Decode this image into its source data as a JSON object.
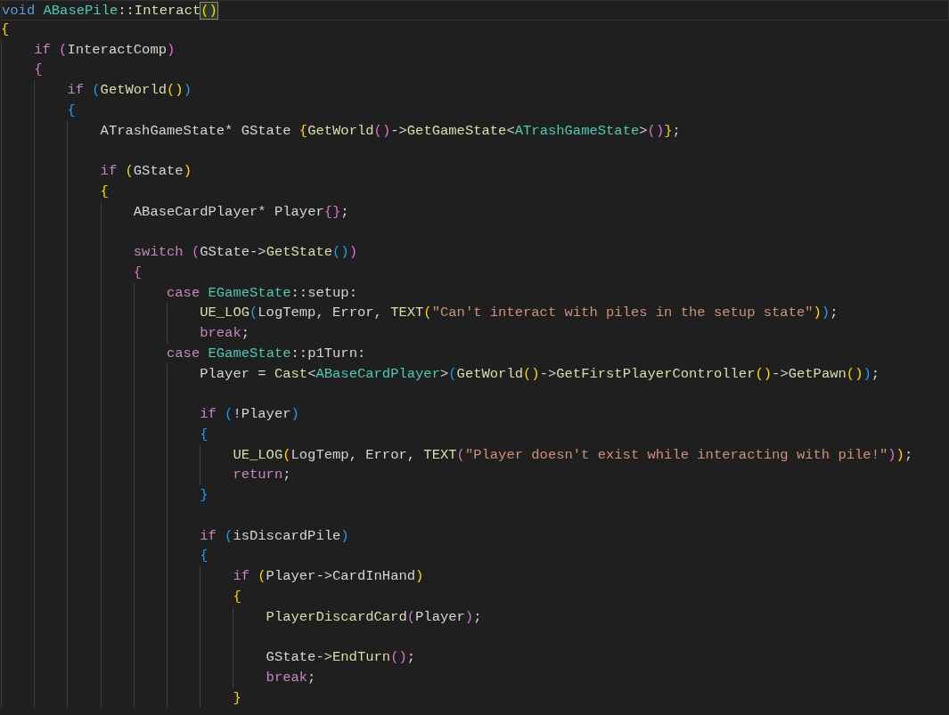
{
  "editor": {
    "lines": [
      {
        "current": true,
        "tokens": [
          {
            "text": "void",
            "kind": "kw"
          },
          {
            "text": " ABasePile",
            "kind": "type"
          },
          {
            "text": "::",
            "kind": "txt"
          },
          {
            "text": "Interact",
            "kind": "fn"
          },
          {
            "text": "()",
            "kind": "ym"
          }
        ]
      },
      {
        "current": false,
        "tokens": [
          {
            "text": "{",
            "kind": "y"
          }
        ],
        "children": [
          {
            "current": false,
            "tokens": [
              {
                "text": "if",
                "kind": "ctl"
              },
              {
                "text": " (",
                "kind": "p"
              },
              {
                "text": "InteractComp",
                "kind": "txt"
              },
              {
                "text": ")",
                "kind": "p"
              }
            ]
          },
          {
            "current": false,
            "tokens": [
              {
                "text": "{",
                "kind": "p"
              }
            ],
            "children": [
              {
                "current": false,
                "tokens": [
                  {
                    "text": "if",
                    "kind": "ctl"
                  },
                  {
                    "text": " (",
                    "kind": "b"
                  },
                  {
                    "text": "GetWorld",
                    "kind": "fn"
                  },
                  {
                    "text": "()",
                    "kind": "y"
                  },
                  {
                    "text": ")",
                    "kind": "b"
                  }
                ]
              },
              {
                "current": false,
                "tokens": [
                  {
                    "text": "{",
                    "kind": "b"
                  }
                ],
                "children": [
                  {
                    "current": false,
                    "tokens": [
                      {
                        "text": "ATrashGameState* GState ",
                        "kind": "txt"
                      },
                      {
                        "text": "{",
                        "kind": "y"
                      },
                      {
                        "text": "GetWorld",
                        "kind": "fn"
                      },
                      {
                        "text": "()",
                        "kind": "p"
                      },
                      {
                        "text": "->",
                        "kind": "txt"
                      },
                      {
                        "text": "GetGameState",
                        "kind": "fn"
                      },
                      {
                        "text": "<",
                        "kind": "txt"
                      },
                      {
                        "text": "ATrashGameState",
                        "kind": "type"
                      },
                      {
                        "text": ">",
                        "kind": "txt"
                      },
                      {
                        "text": "()",
                        "kind": "p"
                      },
                      {
                        "text": "}",
                        "kind": "y"
                      },
                      {
                        "text": ";",
                        "kind": "txt"
                      }
                    ]
                  },
                  {
                    "current": false
                  },
                  {
                    "current": false,
                    "tokens": [
                      {
                        "text": "if",
                        "kind": "ctl"
                      },
                      {
                        "text": " (",
                        "kind": "y"
                      },
                      {
                        "text": "GState",
                        "kind": "txt"
                      },
                      {
                        "text": ")",
                        "kind": "y"
                      }
                    ]
                  },
                  {
                    "current": false,
                    "tokens": [
                      {
                        "text": "{",
                        "kind": "y"
                      }
                    ],
                    "children": [
                      {
                        "current": false,
                        "tokens": [
                          {
                            "text": "ABaseCardPlayer* Player",
                            "kind": "txt"
                          },
                          {
                            "text": "{}",
                            "kind": "p"
                          },
                          {
                            "text": ";",
                            "kind": "txt"
                          }
                        ]
                      },
                      {
                        "current": false
                      },
                      {
                        "current": false,
                        "tokens": [
                          {
                            "text": "switch",
                            "kind": "ctl"
                          },
                          {
                            "text": " (",
                            "kind": "p"
                          },
                          {
                            "text": "GState->",
                            "kind": "txt"
                          },
                          {
                            "text": "GetState",
                            "kind": "fn"
                          },
                          {
                            "text": "()",
                            "kind": "b"
                          },
                          {
                            "text": ")",
                            "kind": "p"
                          }
                        ]
                      },
                      {
                        "current": false,
                        "tokens": [
                          {
                            "text": "{",
                            "kind": "p"
                          }
                        ],
                        "children": [
                          {
                            "current": false,
                            "tokens": [
                              {
                                "text": "case",
                                "kind": "ctl"
                              },
                              {
                                "text": " EGameState",
                                "kind": "type"
                              },
                              {
                                "text": "::setup:",
                                "kind": "txt"
                              }
                            ],
                            "children": [
                              {
                                "current": false,
                                "tokens": [
                                  {
                                    "text": "UE_LOG",
                                    "kind": "fn"
                                  },
                                  {
                                    "text": "(",
                                    "kind": "b"
                                  },
                                  {
                                    "text": "LogTemp, Error, ",
                                    "kind": "txt"
                                  },
                                  {
                                    "text": "TEXT",
                                    "kind": "fn"
                                  },
                                  {
                                    "text": "(",
                                    "kind": "y"
                                  },
                                  {
                                    "text": "\"Can't interact with piles in the setup state\"",
                                    "kind": "str"
                                  },
                                  {
                                    "text": ")",
                                    "kind": "y"
                                  },
                                  {
                                    "text": ")",
                                    "kind": "b"
                                  },
                                  {
                                    "text": ";",
                                    "kind": "txt"
                                  }
                                ]
                              },
                              {
                                "current": false,
                                "tokens": [
                                  {
                                    "text": "break",
                                    "kind": "ctl"
                                  },
                                  {
                                    "text": ";",
                                    "kind": "txt"
                                  }
                                ]
                              }
                            ]
                          },
                          {
                            "current": false,
                            "tokens": [
                              {
                                "text": "case",
                                "kind": "ctl"
                              },
                              {
                                "text": " EGameState",
                                "kind": "type"
                              },
                              {
                                "text": "::p1Turn:",
                                "kind": "txt"
                              }
                            ],
                            "children": [
                              {
                                "current": false,
                                "tokens": [
                                  {
                                    "text": "Player = ",
                                    "kind": "txt"
                                  },
                                  {
                                    "text": "Cast",
                                    "kind": "fn"
                                  },
                                  {
                                    "text": "<",
                                    "kind": "txt"
                                  },
                                  {
                                    "text": "ABaseCardPlayer",
                                    "kind": "type"
                                  },
                                  {
                                    "text": ">",
                                    "kind": "txt"
                                  },
                                  {
                                    "text": "(",
                                    "kind": "b"
                                  },
                                  {
                                    "text": "GetWorld",
                                    "kind": "fn"
                                  },
                                  {
                                    "text": "()",
                                    "kind": "y"
                                  },
                                  {
                                    "text": "->",
                                    "kind": "txt"
                                  },
                                  {
                                    "text": "GetFirstPlayerController",
                                    "kind": "fn"
                                  },
                                  {
                                    "text": "()",
                                    "kind": "y"
                                  },
                                  {
                                    "text": "->",
                                    "kind": "txt"
                                  },
                                  {
                                    "text": "GetPawn",
                                    "kind": "fn"
                                  },
                                  {
                                    "text": "()",
                                    "kind": "y"
                                  },
                                  {
                                    "text": ")",
                                    "kind": "b"
                                  },
                                  {
                                    "text": ";",
                                    "kind": "txt"
                                  }
                                ]
                              },
                              {
                                "current": false
                              },
                              {
                                "current": false,
                                "tokens": [
                                  {
                                    "text": "if",
                                    "kind": "ctl"
                                  },
                                  {
                                    "text": " (",
                                    "kind": "b"
                                  },
                                  {
                                    "text": "!Player",
                                    "kind": "txt"
                                  },
                                  {
                                    "text": ")",
                                    "kind": "b"
                                  }
                                ]
                              },
                              {
                                "current": false,
                                "tokens": [
                                  {
                                    "text": "{",
                                    "kind": "b"
                                  }
                                ],
                                "children": [
                                  {
                                    "current": false,
                                    "tokens": [
                                      {
                                        "text": "UE_LOG",
                                        "kind": "fn"
                                      },
                                      {
                                        "text": "(",
                                        "kind": "y"
                                      },
                                      {
                                        "text": "LogTemp, Error, ",
                                        "kind": "txt"
                                      },
                                      {
                                        "text": "TEXT",
                                        "kind": "fn"
                                      },
                                      {
                                        "text": "(",
                                        "kind": "p"
                                      },
                                      {
                                        "text": "\"Player doesn't exist while interacting with pile!\"",
                                        "kind": "str"
                                      },
                                      {
                                        "text": ")",
                                        "kind": "p"
                                      },
                                      {
                                        "text": ")",
                                        "kind": "y"
                                      },
                                      {
                                        "text": ";",
                                        "kind": "txt"
                                      }
                                    ]
                                  },
                                  {
                                    "current": false,
                                    "tokens": [
                                      {
                                        "text": "return",
                                        "kind": "ctl"
                                      },
                                      {
                                        "text": ";",
                                        "kind": "txt"
                                      }
                                    ]
                                  }
                                ]
                              },
                              {
                                "current": false,
                                "tokens": [
                                  {
                                    "text": "}",
                                    "kind": "b"
                                  }
                                ]
                              },
                              {
                                "current": false
                              },
                              {
                                "current": false,
                                "tokens": [
                                  {
                                    "text": "if",
                                    "kind": "ctl"
                                  },
                                  {
                                    "text": " (",
                                    "kind": "b"
                                  },
                                  {
                                    "text": "isDiscardPile",
                                    "kind": "txt"
                                  },
                                  {
                                    "text": ")",
                                    "kind": "b"
                                  }
                                ]
                              },
                              {
                                "current": false,
                                "tokens": [
                                  {
                                    "text": "{",
                                    "kind": "b"
                                  }
                                ],
                                "children": [
                                  {
                                    "current": false,
                                    "tokens": [
                                      {
                                        "text": "if",
                                        "kind": "ctl"
                                      },
                                      {
                                        "text": " (",
                                        "kind": "y"
                                      },
                                      {
                                        "text": "Player->CardInHand",
                                        "kind": "txt"
                                      },
                                      {
                                        "text": ")",
                                        "kind": "y"
                                      }
                                    ]
                                  },
                                  {
                                    "current": false,
                                    "tokens": [
                                      {
                                        "text": "{",
                                        "kind": "y"
                                      }
                                    ],
                                    "children": [
                                      {
                                        "current": false,
                                        "tokens": [
                                          {
                                            "text": "PlayerDiscardCard",
                                            "kind": "fn"
                                          },
                                          {
                                            "text": "(",
                                            "kind": "p"
                                          },
                                          {
                                            "text": "Player",
                                            "kind": "txt"
                                          },
                                          {
                                            "text": ")",
                                            "kind": "p"
                                          },
                                          {
                                            "text": ";",
                                            "kind": "txt"
                                          }
                                        ]
                                      },
                                      {
                                        "current": false
                                      },
                                      {
                                        "current": false,
                                        "tokens": [
                                          {
                                            "text": "GState->",
                                            "kind": "txt"
                                          },
                                          {
                                            "text": "EndTurn",
                                            "kind": "fn"
                                          },
                                          {
                                            "text": "()",
                                            "kind": "p"
                                          },
                                          {
                                            "text": ";",
                                            "kind": "txt"
                                          }
                                        ]
                                      },
                                      {
                                        "current": false,
                                        "tokens": [
                                          {
                                            "text": "break",
                                            "kind": "ctl"
                                          },
                                          {
                                            "text": ";",
                                            "kind": "txt"
                                          }
                                        ]
                                      }
                                    ]
                                  },
                                  {
                                    "current": false,
                                    "tokens": [
                                      {
                                        "text": "}",
                                        "kind": "y"
                                      }
                                    ]
                                  }
                                ]
                              }
                            ]
                          }
                        ]
                      }
                    ]
                  }
                ]
              }
            ]
          }
        ]
      }
    ]
  }
}
